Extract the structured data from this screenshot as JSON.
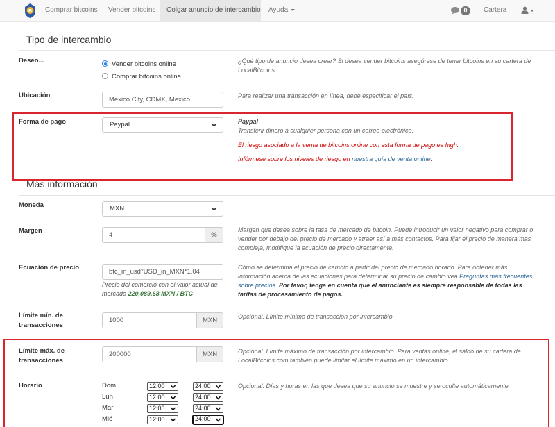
{
  "navbar": {
    "items": [
      "Comprar bitcoins",
      "Vender bitcoins",
      "Colgar anuncio de intercambio",
      "Ayuda"
    ],
    "messages_count": "0",
    "wallet": "Cartera"
  },
  "tipo": {
    "title": "Tipo de intercambio",
    "deseo_label": "Deseo...",
    "radio_sell": "Vender bitcoins online",
    "radio_buy": "Comprar bitcoins online",
    "deseo_help": "¿Qué tipo de anuncio desea crear? Si desea vender bitcoins asegúrese de tener bitcoins en su cartera de LocalBitcoins.",
    "ubicacion_label": "Ubicación",
    "ubicacion_value": "Mexico City, CDMX, Mexico",
    "ubicacion_help": "Para realizar una transacción en línea, debe especificar el país.",
    "forma_label": "Forma de pago",
    "forma_value": "Paypal",
    "forma_help_title": "Paypal",
    "forma_help_desc": "Transferir dinero a cualquier persona con un correo electrónico.",
    "forma_risk": "El riesgo asociado a la venta de bitcoins online con esta forma de pago es high.",
    "forma_info_prefix": "Infórmese sobre los niveles de riesgo en ",
    "forma_info_link": "nuestra guía de venta online",
    "forma_info_suffix": "."
  },
  "mas": {
    "title": "Más información",
    "moneda_label": "Moneda",
    "moneda_value": "MXN",
    "margen_label": "Margen",
    "margen_value": "4",
    "margen_addon": "%",
    "margen_help": "Margen que desea sobre la tasa de mercado de bitcoin. Puede introducir un valor negativo para comprar o vender por debajo del precio de mercado y atraer así a más contactos. Para fijar el precio de manera más compleja, modifique la ecuación de precio directamente.",
    "ecuacion_label": "Ecuación de precio",
    "ecuacion_value": "btc_in_usd*USD_in_MXN*1.04",
    "ecuacion_note_prefix": "Precio del comercio con el valor actual de mercado ",
    "ecuacion_note_value": "220,089.68 MXN / BTC",
    "ecuacion_help_1": "Cómo se determina el precio de cambio a partir del precio de mercado horario. Para obtener más información acerca de las ecuaciones para determinar su precio de cambio vea ",
    "ecuacion_help_link": "Preguntas más frecuentes sobre precios",
    "ecuacion_help_2": ". ",
    "ecuacion_help_bold": "Por favor, tenga en cuenta que el anunciante es siempre responsable de todas las tarifas de procesamiento de pagos.",
    "min_label_1": "Límite mín. de",
    "min_label_2": "transacciones",
    "min_value": "1000",
    "min_addon": "MXN",
    "min_help": "Opcional. Límite mínimo de transacción por intercambio.",
    "max_label_1": "Límite máx. de",
    "max_label_2": "transacciones",
    "max_value": "200000",
    "max_addon": "MXN",
    "max_help": "Opcional. Límite máximo de transacción por intercambio. Para ventas online, el saldo de su cartera de LocalBitcoins.com también puede limitar el límite máximo en un intercambio.",
    "horario_label": "Horario",
    "horario_help": "Opcional. Días y horas en las que desea que su anuncio se muestre y se oculte automáticamente.",
    "days": [
      {
        "name": "Dom",
        "start": "12:00",
        "end": "24:00"
      },
      {
        "name": "Lun",
        "start": "12:00",
        "end": "24:00"
      },
      {
        "name": "Mar",
        "start": "12:00",
        "end": "24:00"
      },
      {
        "name": "Mié",
        "start": "12:00",
        "end": "24:00"
      }
    ]
  },
  "colors": {
    "highlight_box": "#d9262e",
    "risk_text": "#cc0000",
    "link": "#2a6496",
    "price_green": "#3c763d"
  }
}
